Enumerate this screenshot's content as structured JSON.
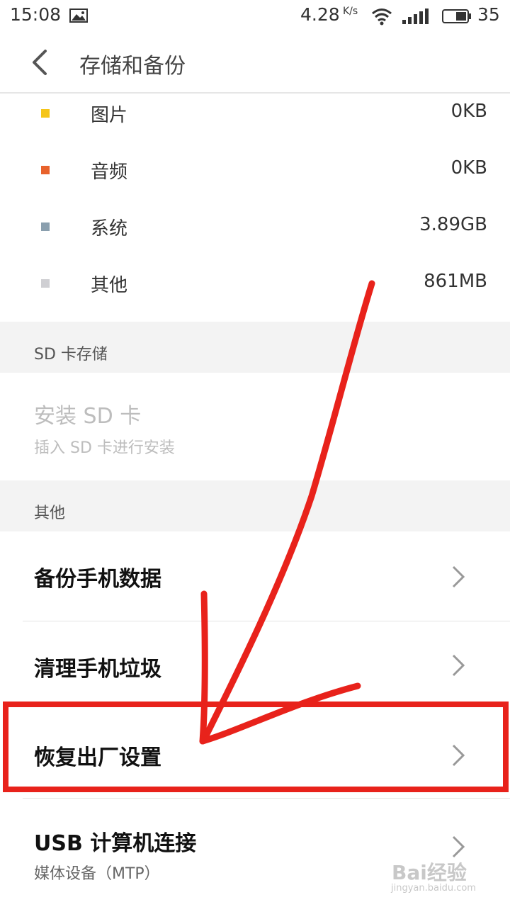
{
  "status_bar": {
    "time": "15:08",
    "net_speed": "4.28",
    "net_unit": "K/s",
    "battery": "35",
    "icons": [
      "image-icon",
      "wifi-icon",
      "signal-icon",
      "battery-icon"
    ]
  },
  "header": {
    "title": "存储和备份",
    "back_icon": "back-arrow-icon"
  },
  "storage_breakdown": [
    {
      "label": "图片",
      "value": "0KB",
      "color": "#F5C518"
    },
    {
      "label": "音频",
      "value": "0KB",
      "color": "#E8622C"
    },
    {
      "label": "系统",
      "value": "3.89GB",
      "color": "#8A9FAE"
    },
    {
      "label": "其他",
      "value": "861MB",
      "color": "#CFCFD3"
    }
  ],
  "sd_section": {
    "header": "SD 卡存储",
    "title": "安装 SD 卡",
    "subtitle": "插入 SD 卡进行安装"
  },
  "other_section": {
    "header": "其他",
    "items": [
      {
        "title": "备份手机数据"
      },
      {
        "title": "清理手机垃圾"
      },
      {
        "title": "恢复出厂设置"
      },
      {
        "title": "USB 计算机连接",
        "subtitle": "媒体设备（MTP）"
      }
    ]
  },
  "annotation": {
    "highlight_color": "#E8221B"
  },
  "watermark": {
    "brand": "Bai经验",
    "url": "jingyan.baidu.com"
  }
}
